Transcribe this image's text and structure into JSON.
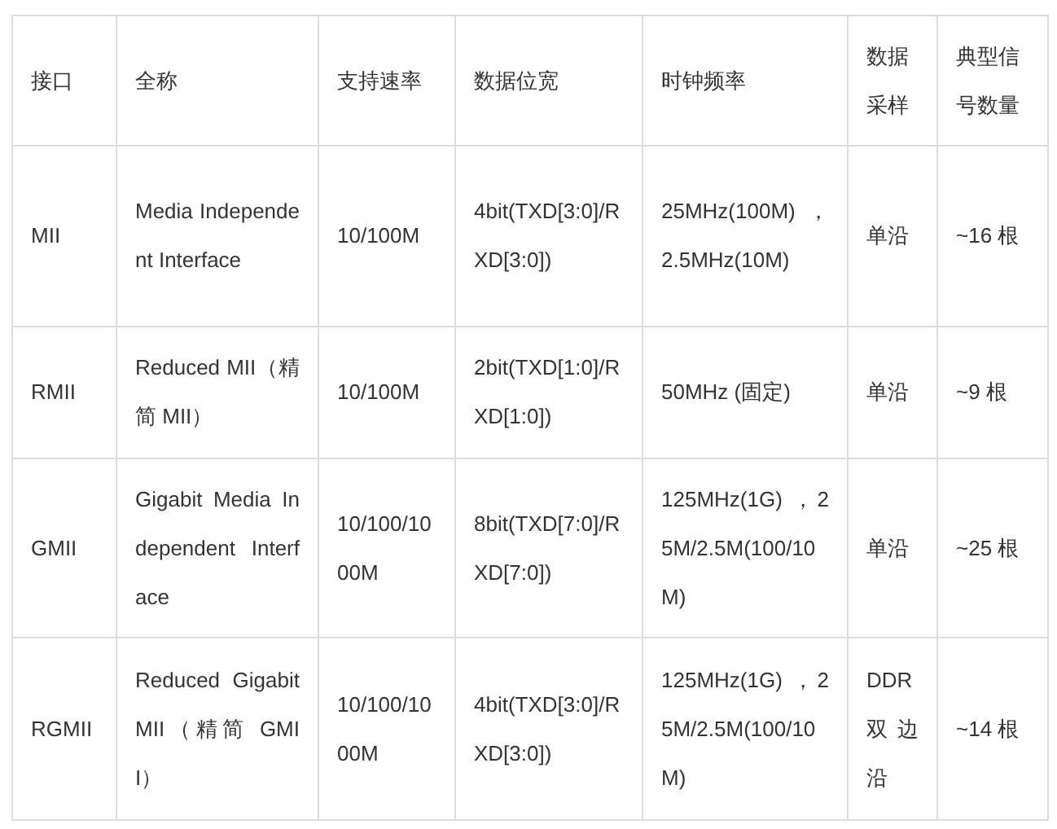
{
  "table": {
    "columns": [
      "接口",
      "全称",
      "支持速率",
      "数据位宽",
      "时钟频率",
      "数据采样",
      "典型信号数量"
    ],
    "rows": [
      [
        "MII",
        "Media Independent Interface",
        "10/100M",
        "4bit(TXD[3:0]/RXD[3:0])",
        "25MHz(100M)，2.5MHz(10M)",
        "单沿",
        "~16 根"
      ],
      [
        "RMII",
        "Reduced MII（精简 MII）",
        "10/100M",
        "2bit(TXD[1:0]/RXD[1:0])",
        "50MHz (固定)",
        "单沿",
        "~9 根"
      ],
      [
        "GMII",
        "Gigabit Media Independent Interface",
        "10/100/1000M",
        "8bit(TXD[7:0]/RXD[7:0])",
        "125MHz(1G) ，25M/2.5M(100/10M)",
        "单沿",
        "~25 根"
      ],
      [
        "RGMII",
        "Reduced Gigabit MII（精简 GMII）",
        "10/100/1000M",
        "4bit(TXD[3:0]/RXD[3:0])",
        "125MHz(1G) ，25M/2.5M(100/10M)",
        "DDR 双边沿",
        "~14 根"
      ]
    ]
  }
}
